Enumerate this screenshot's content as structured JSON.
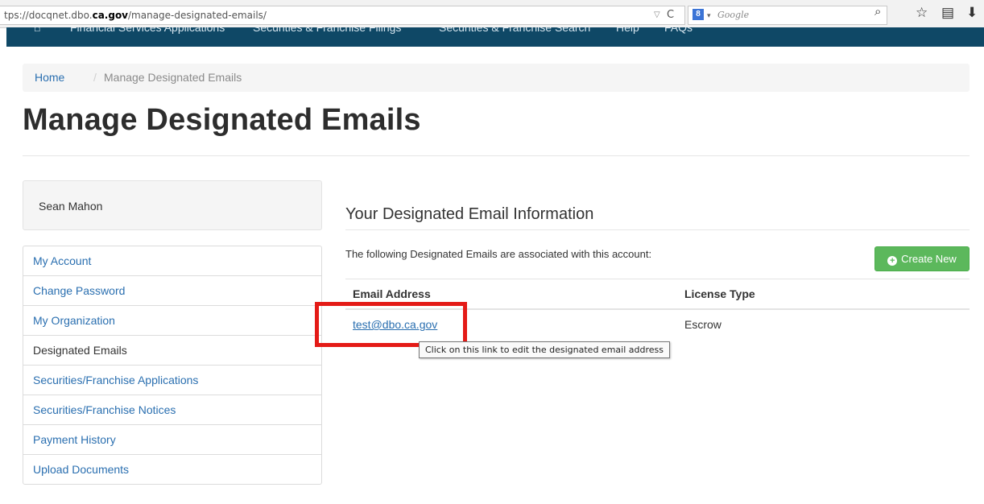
{
  "browser": {
    "url_prefix": "tps://docqnet.dbo.",
    "url_domain": "ca.gov",
    "url_path": "/manage-designated-emails/",
    "search_engine_label": "8",
    "search_placeholder": "Google"
  },
  "site_nav": {
    "items": [
      "Financial Services Applications",
      "Securities & Franchise Filings",
      "Securities & Franchise Search",
      "Help",
      "FAQs"
    ]
  },
  "breadcrumb": {
    "home": "Home",
    "separator": "/",
    "current": "Manage Designated Emails"
  },
  "page_title": "Manage Designated Emails",
  "sidebar": {
    "user_name": "Sean Mahon",
    "items": [
      {
        "label": "My Account",
        "active": false
      },
      {
        "label": "Change Password",
        "active": false
      },
      {
        "label": "My Organization",
        "active": false
      },
      {
        "label": "Designated Emails",
        "active": true
      },
      {
        "label": "Securities/Franchise Applications",
        "active": false
      },
      {
        "label": "Securities/Franchise Notices",
        "active": false
      },
      {
        "label": "Payment History",
        "active": false
      },
      {
        "label": "Upload Documents",
        "active": false
      }
    ]
  },
  "main": {
    "section_heading": "Your Designated Email Information",
    "intro": "The following Designated Emails are associated with this account:",
    "create_button_label": "Create New",
    "table": {
      "headers": [
        "Email Address",
        "License Type"
      ],
      "rows": [
        {
          "email": "test@dbo.ca.gov",
          "license_type": "Escrow"
        }
      ]
    },
    "tooltip": "Click on this link to edit the designated email address"
  },
  "colors": {
    "nav_bar": "#0f4866",
    "link": "#2a6fb0",
    "button_green": "#5cb85c",
    "highlight_red": "#e41b17"
  }
}
